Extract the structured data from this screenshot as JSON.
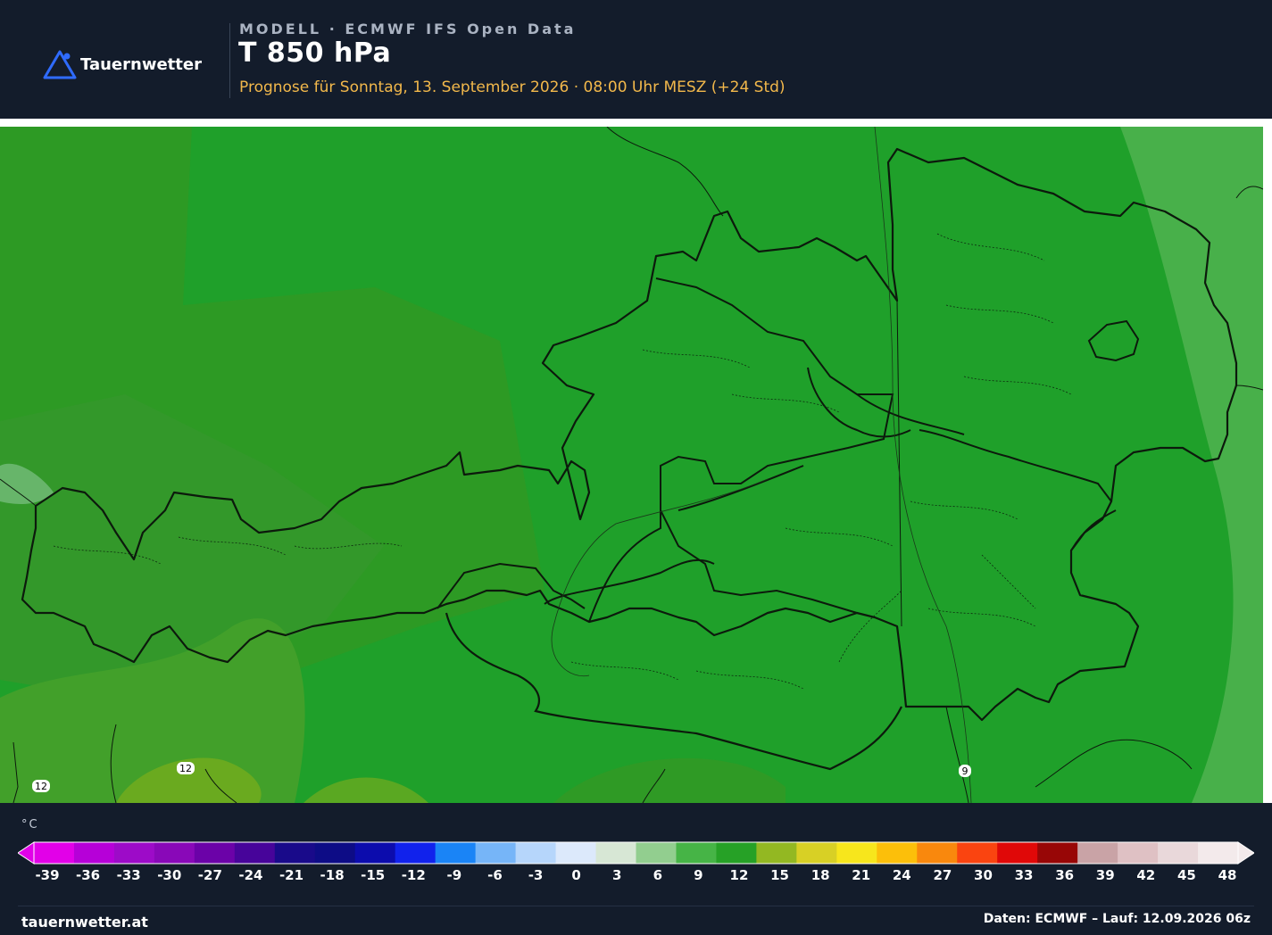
{
  "header": {
    "brand": "Tauernwetter",
    "model_line": "MODELL · ECMWF IFS Open Data",
    "title": "T 850 hPa",
    "subtitle": "Prognose für Sonntag, 13. September 2026 · 08:00 Uhr MESZ  (+24 Std)"
  },
  "map": {
    "contour_labels": [
      "12",
      "12",
      "9"
    ],
    "colors": {
      "field_9_12": "#1fa02a",
      "field_warm": "#2b9e26",
      "field_12_15": "#6aaa1f",
      "field_6_9": "#48b04a",
      "borders": "#0c1a0c"
    }
  },
  "legend": {
    "unit": "°C",
    "ticks": [
      "-39",
      "-36",
      "-33",
      "-30",
      "-27",
      "-24",
      "-21",
      "-18",
      "-15",
      "-12",
      "-9",
      "-6",
      "-3",
      "0",
      "3",
      "6",
      "9",
      "12",
      "15",
      "18",
      "21",
      "24",
      "27",
      "30",
      "33",
      "36",
      "39",
      "42",
      "45",
      "48"
    ],
    "colors": [
      "#e200e8",
      "#b600d8",
      "#9d0bc8",
      "#8908b8",
      "#6b02a8",
      "#47049a",
      "#190a8a",
      "#0d0c86",
      "#0c0cad",
      "#1122ec",
      "#1a84f6",
      "#76b5f8",
      "#b6d6fb",
      "#dce9fb",
      "#d7e7d5",
      "#92ce8f",
      "#46b446",
      "#26a126",
      "#93b822",
      "#d8d025",
      "#f7e61c",
      "#fcbf0a",
      "#f9880d",
      "#fa4410",
      "#e00808",
      "#980606",
      "#c9a3a6",
      "#dfc1c4",
      "#e9d8da",
      "#f3eaeb"
    ]
  },
  "footer": {
    "site": "tauernwetter.at",
    "source": "Daten: ECMWF – Lauf: 12.09.2026 06z"
  }
}
